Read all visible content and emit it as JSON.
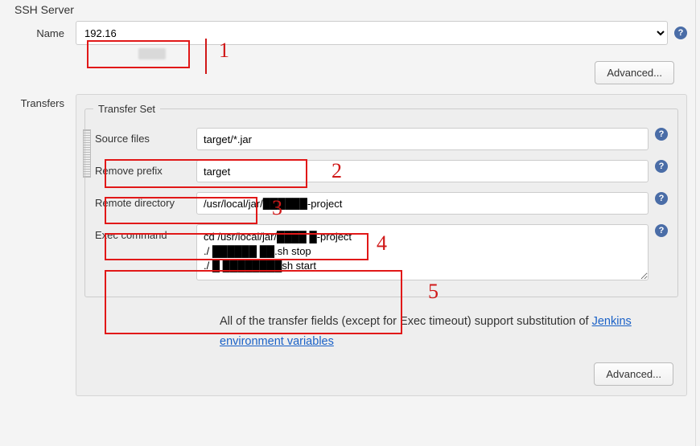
{
  "section_title": "SSH Server",
  "name": {
    "label": "Name",
    "selected": "192.16",
    "redacted_tail": "█████"
  },
  "advanced_button": "Advanced...",
  "transfers_label": "Transfers",
  "transfer_set": {
    "legend": "Transfer Set",
    "source_files": {
      "label": "Source files",
      "value": "target/*.jar"
    },
    "remove_prefix": {
      "label": "Remove prefix",
      "value": "target"
    },
    "remote_directory": {
      "label": "Remote directory",
      "value": "/usr/local/jar/██████-project"
    },
    "exec_command": {
      "label": "Exec command",
      "value": "cd /usr/local/jar/████ █-project\n./ ██████ ██.sh stop\n./ █ ████████sh start"
    }
  },
  "note": {
    "text_before": "All of the transfer fields (except for Exec timeout) support substitution of ",
    "link_text": "Jenkins environment variables"
  },
  "annotations": [
    "1",
    "2",
    "3",
    "4",
    "5"
  ]
}
